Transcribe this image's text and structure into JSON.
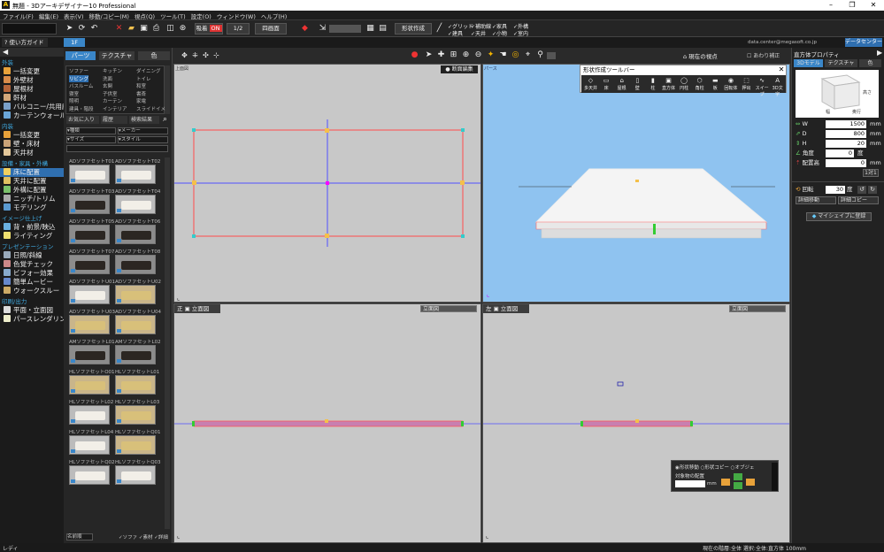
{
  "window": {
    "title": "無題 - 3Dアーキデザイナー10 Professional",
    "controls": [
      "–",
      "❐",
      "✕"
    ]
  },
  "menu": [
    "ファイル(F)",
    "編集(E)",
    "表示(V)",
    "移動/コピー(M)",
    "視点(Q)",
    "ツール(T)",
    "設定(O)",
    "ウィンドウ(W)",
    "ヘルプ(H)"
  ],
  "toolbar": {
    "snap_label": "吸着",
    "snap_state": "ON",
    "page": "1/2",
    "view_mode": "四画面",
    "shape_button": "形状作成",
    "checks_a": [
      "グリッド",
      "補助線",
      "家具",
      "外構"
    ],
    "checks_b": [
      "建具",
      "天井",
      "小物",
      "室内"
    ]
  },
  "guide": {
    "label": "使い方ガイド",
    "floor_tab": "1F",
    "user_label": "data.center@megasoft.co.jp",
    "datacenter": "データセンター"
  },
  "left": {
    "sections": [
      {
        "title": "外装",
        "items": [
          "一括変更",
          "外壁材",
          "屋根材",
          "軒材",
          "バルコニー/共用廊下",
          "カーテンウォール"
        ]
      },
      {
        "title": "内装",
        "items": [
          "一括変更",
          "壁・床材",
          "天井材"
        ]
      },
      {
        "title": "設備・家具・外構",
        "items": [
          "床に配置",
          "天井に配置",
          "外構に配置",
          "ニッチ/トリム",
          "モデリング"
        ]
      },
      {
        "title": "イメージ仕上げ",
        "items": [
          "背・前景/映込",
          "ライティング"
        ]
      },
      {
        "title": "プレゼンテーション",
        "items": [
          "日照/斜線",
          "色覚チェック",
          "ビフォー効果",
          "簡単ムービー",
          "ウォークスルー"
        ]
      },
      {
        "title": "印刷/出力",
        "items": [
          "平面・立面図",
          "パースレンダリング"
        ]
      }
    ],
    "selected": "床に配置"
  },
  "parts": {
    "tabs": [
      "パーツ",
      "テクスチャ",
      "色"
    ],
    "categories": [
      [
        "ソファー",
        "キッチン",
        "ダイニング"
      ],
      [
        "リビング",
        "洗面",
        "トイレ"
      ],
      [
        "バスルーム",
        "玄関",
        "和室"
      ],
      [
        "寝室",
        "子供室",
        "書斎"
      ],
      [
        "照明",
        "カーテン",
        "家電"
      ],
      [
        "建具・階段",
        "インテリア",
        "スライドイメ"
      ]
    ],
    "filter_buttons": [
      "お気に入り",
      "履歴",
      "検索結果"
    ],
    "dropdowns": [
      "種類",
      "メーカー",
      "サイズ",
      "スタイル"
    ],
    "items": [
      "ADソファセットT01",
      "ADソファセットT02",
      "ADソファセットT03",
      "ADソファセットT04",
      "ADソファセットT05",
      "ADソファセットT06",
      "ADソファセットT07",
      "ADソファセットT08",
      "ADソファセットU01",
      "ADソファセットU02",
      "ADソファセットU03",
      "ADソファセットU04",
      "AMソファセットL01",
      "AMソファセットL02",
      "HLソファセットO01",
      "HLソファセットL01",
      "HLソファセットL02",
      "HLソファセットL03",
      "HLソファセットL04",
      "HLソファセットQ01",
      "HLソファセットQ02",
      "HLソファセットQ03"
    ],
    "footer": {
      "sort": "名前順",
      "options": [
        "ソファ",
        "素材",
        "詳細"
      ]
    }
  },
  "viewbar": {
    "label": "現在の視点",
    "section": "断面編集",
    "scale_label": "あわり補正"
  },
  "shape_toolbar": {
    "title": "形状作成ツールバー",
    "buttons": [
      "多天井",
      "床",
      "屋根",
      "壁",
      "柱",
      "直方体",
      "円柱",
      "角柱",
      "板",
      "回転体",
      "押出",
      "スイープ",
      "3D文字"
    ]
  },
  "viewports": {
    "top": {
      "label": "上面図"
    },
    "persp": {
      "label": "パース"
    },
    "front": {
      "label": "正",
      "mode": "立面図",
      "dropdown": "立面図"
    },
    "side": {
      "label": "左",
      "mode": "立面図",
      "dropdown": "立面図"
    }
  },
  "snap": {
    "options": [
      "形状移動",
      "形状コピー",
      "オブジェ"
    ],
    "label": "対象物の配置",
    "unit": "mm"
  },
  "props": {
    "title": "直方体プロパティ",
    "tabs": [
      "3Dモデル",
      "テクスチャ",
      "色"
    ],
    "preview_labels": [
      "高さ",
      "奥行",
      "幅"
    ],
    "fields": [
      {
        "k": "W",
        "v": "1500",
        "u": "mm"
      },
      {
        "k": "D",
        "v": "800",
        "u": "mm"
      },
      {
        "k": "H",
        "v": "20",
        "u": "mm"
      },
      {
        "k": "角度",
        "v": "0",
        "u": "度"
      },
      {
        "k": "配置高",
        "v": "0",
        "u": "mm"
      }
    ],
    "apply": "1対1",
    "rotation": {
      "label": "回転",
      "value": "30",
      "unit": "度"
    },
    "move": "詳細移動",
    "copy": "詳細コピー",
    "register": "マイシェイプに登録"
  },
  "status": {
    "left": "レディ",
    "right": "現在の階層:全体  選択:全体:直方体  100mm"
  },
  "colors": {
    "accent": "#2f6fb0",
    "persp_bg": "#8fc3f0",
    "viewport_bg": "#c8c8c8"
  }
}
